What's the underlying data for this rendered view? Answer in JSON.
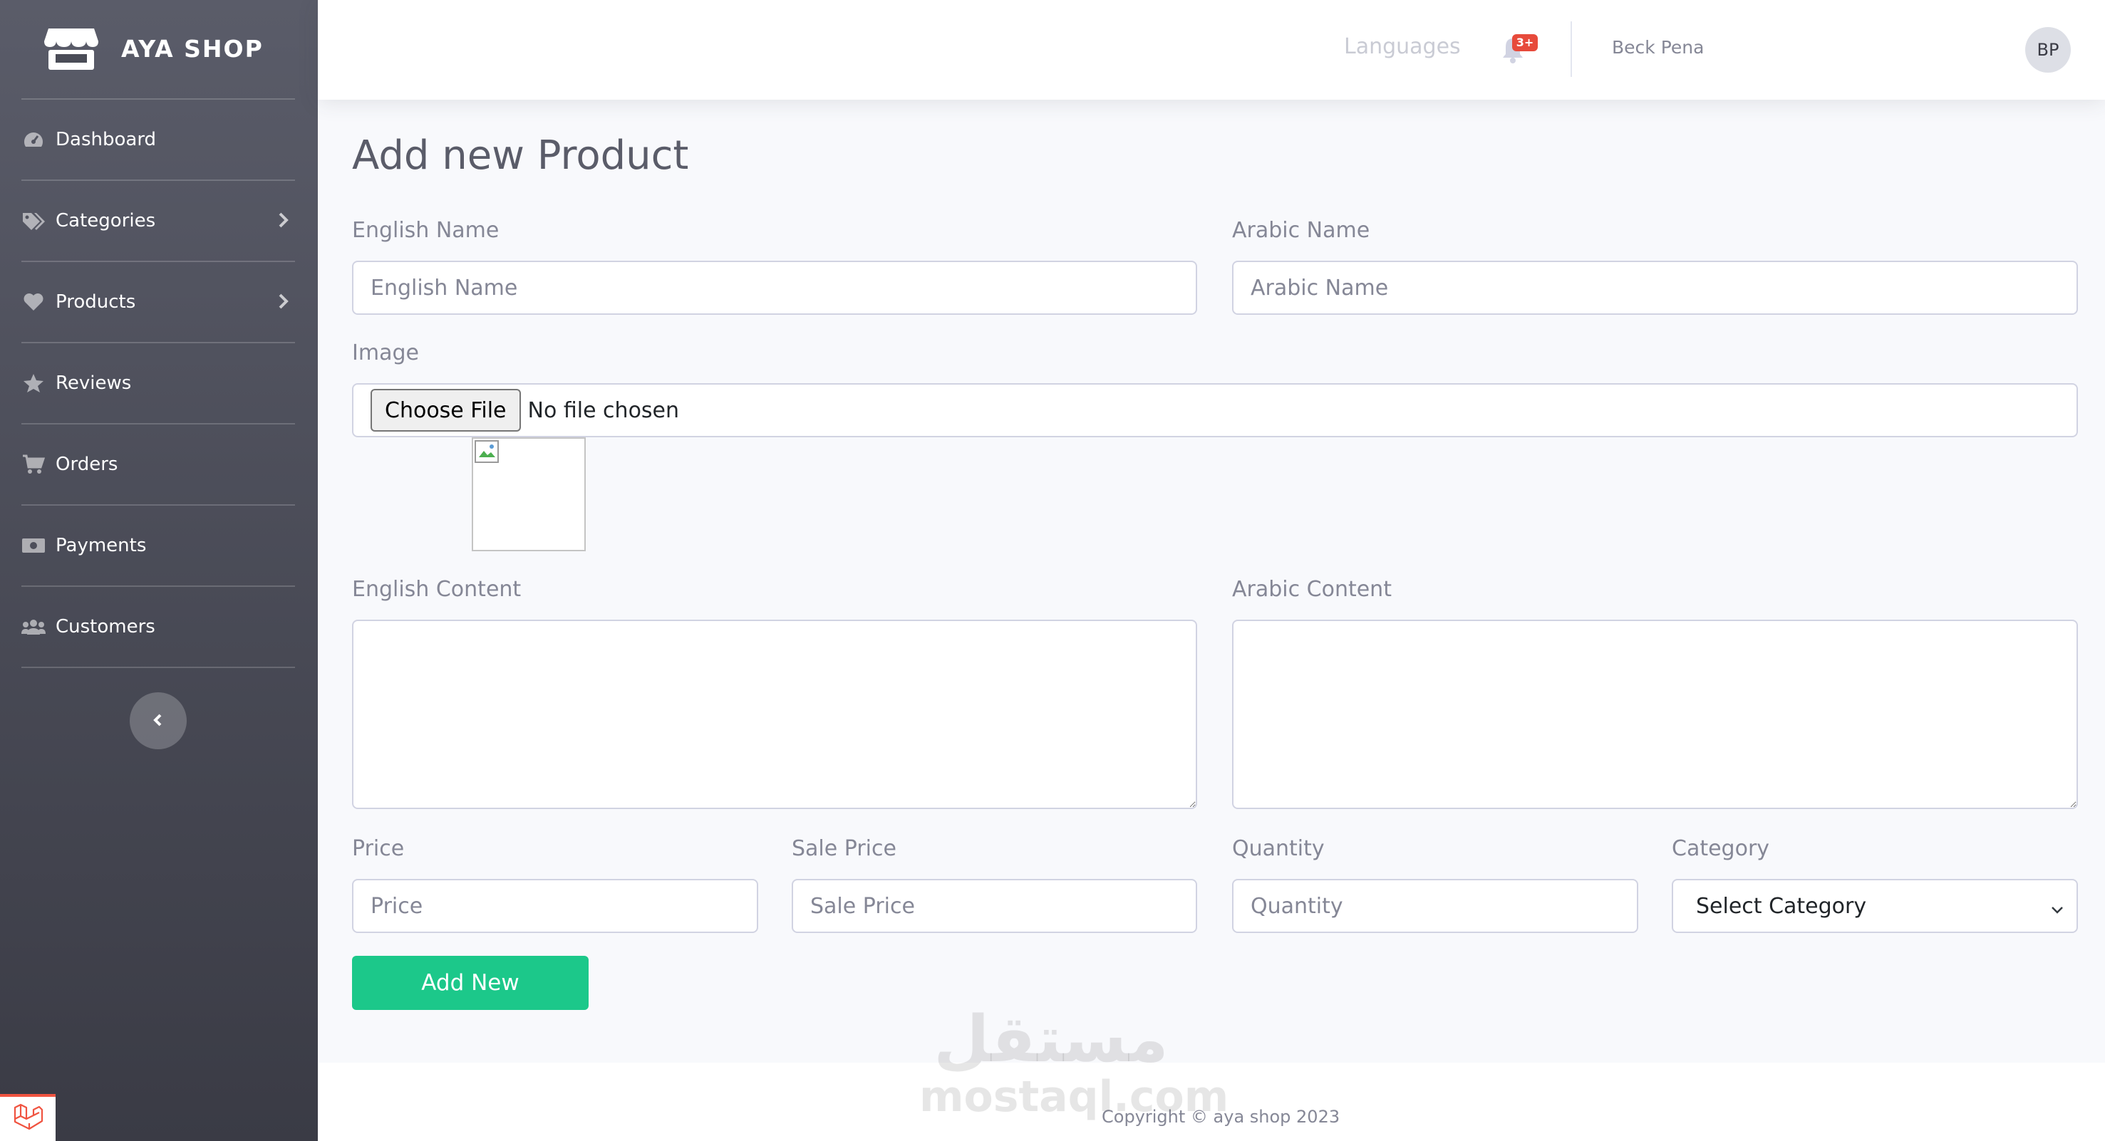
{
  "brand": {
    "name": "AYA SHOP",
    "icon": "store-icon"
  },
  "sidebar": {
    "items": [
      {
        "label": "Dashboard",
        "icon": "tachometer-icon",
        "has_submenu": false
      },
      {
        "label": "Categories",
        "icon": "tags-icon",
        "has_submenu": true
      },
      {
        "label": "Products",
        "icon": "heart-icon",
        "has_submenu": true
      },
      {
        "label": "Reviews",
        "icon": "star-icon",
        "has_submenu": false
      },
      {
        "label": "Orders",
        "icon": "cart-icon",
        "has_submenu": false
      },
      {
        "label": "Payments",
        "icon": "money-bill-icon",
        "has_submenu": false
      },
      {
        "label": "Customers",
        "icon": "users-icon",
        "has_submenu": false
      }
    ],
    "collapse_icon": "chevron-left-icon"
  },
  "topbar": {
    "languages_label": "Languages",
    "notification_count": "3+",
    "user_name": "Beck Pena",
    "avatar_initials": "BP"
  },
  "page": {
    "title": "Add new Product"
  },
  "form": {
    "english_name": {
      "label": "English Name",
      "placeholder": "English Name",
      "value": ""
    },
    "arabic_name": {
      "label": "Arabic Name",
      "placeholder": "Arabic Name",
      "value": ""
    },
    "image": {
      "label": "Image",
      "button_label": "Choose File",
      "status": "No file chosen"
    },
    "english_content": {
      "label": "English Content",
      "value": ""
    },
    "arabic_content": {
      "label": "Arabic Content",
      "value": ""
    },
    "price": {
      "label": "Price",
      "placeholder": "Price",
      "value": ""
    },
    "sale_price": {
      "label": "Sale Price",
      "placeholder": "Sale Price",
      "value": ""
    },
    "quantity": {
      "label": "Quantity",
      "placeholder": "Quantity",
      "value": ""
    },
    "category": {
      "label": "Category",
      "selected": "Select Category"
    },
    "submit_label": "Add New"
  },
  "watermark": {
    "arabic": "مستقل",
    "latin": "mostaql.com"
  },
  "footer": {
    "copyright": "Copyright © aya shop 2023"
  },
  "colors": {
    "sidebar_top": "#5a5c69",
    "sidebar_bottom": "#3a3b45",
    "success": "#1cc88a",
    "badge": "#e74a3b",
    "text_muted": "#858796"
  }
}
